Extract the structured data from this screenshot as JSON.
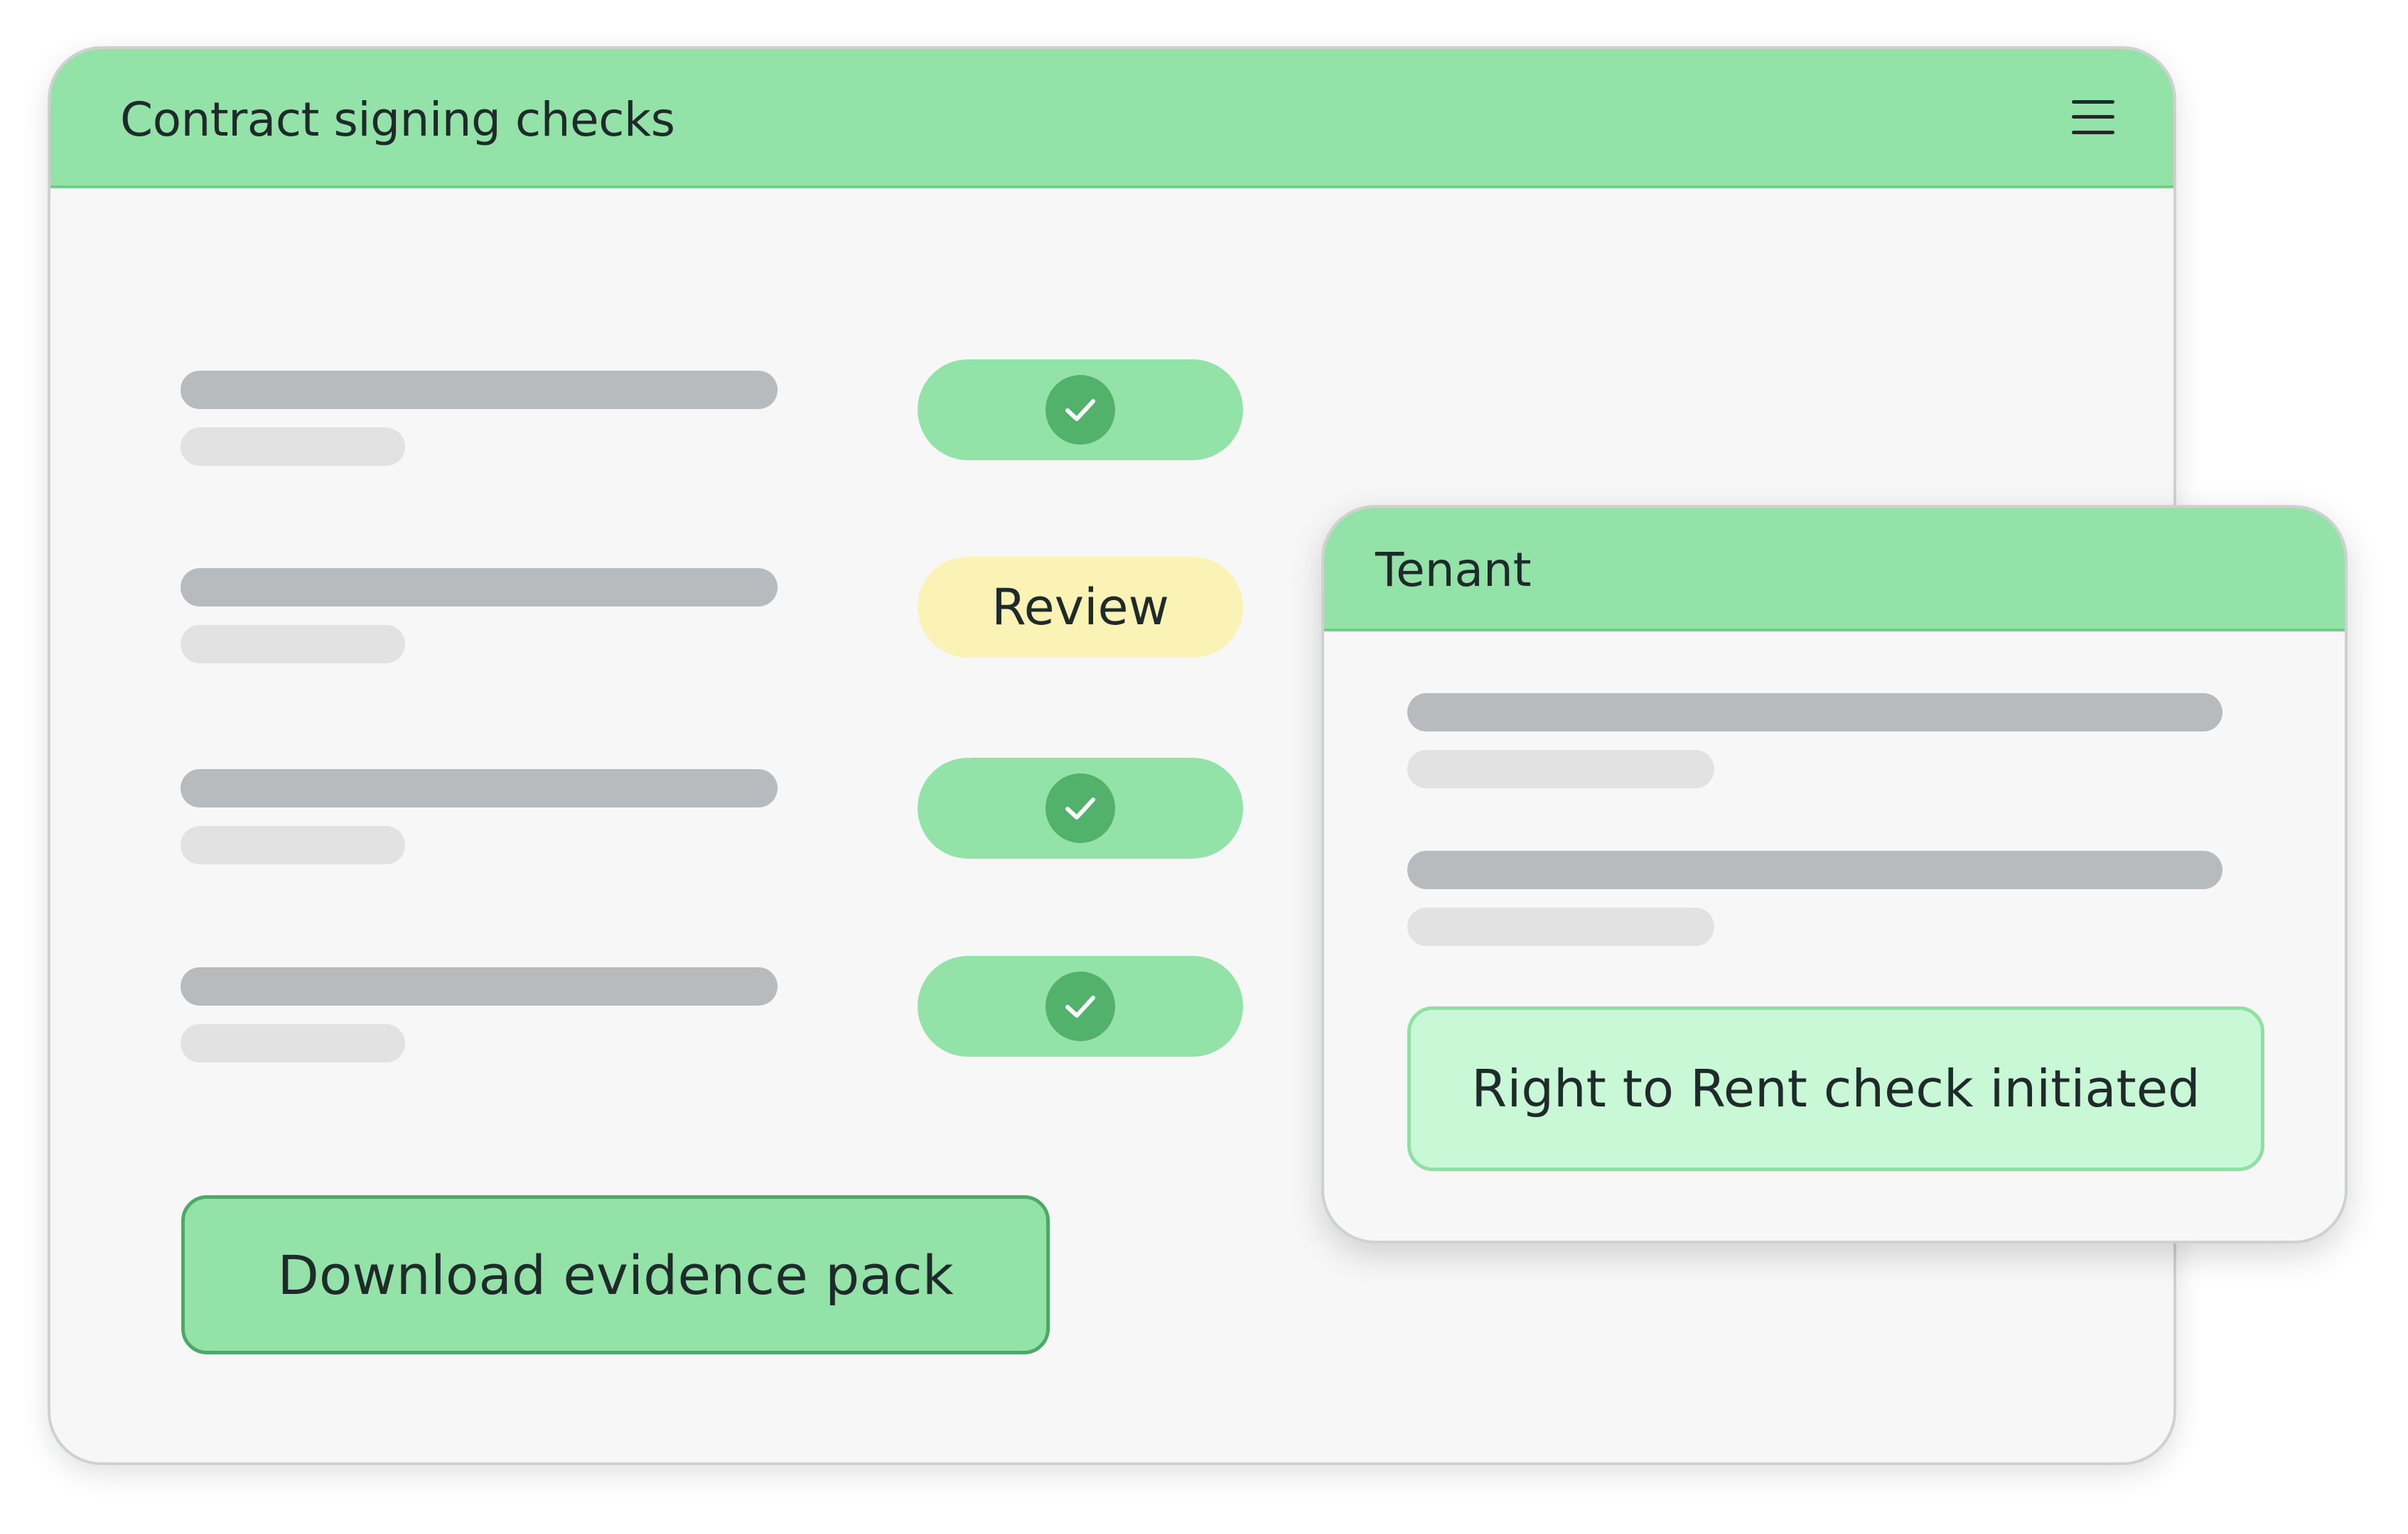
{
  "main_window": {
    "title": "Contract signing checks",
    "menu_icon": "hamburger-menu-icon",
    "checks": [
      {
        "status": "passed",
        "icon": "checkmark-icon",
        "label": ""
      },
      {
        "status": "review",
        "icon": "",
        "label": "Review"
      },
      {
        "status": "passed",
        "icon": "checkmark-icon",
        "label": ""
      },
      {
        "status": "passed",
        "icon": "checkmark-icon",
        "label": ""
      }
    ],
    "download_label": "Download evidence pack"
  },
  "tenant_card": {
    "title": "Tenant",
    "status_text": "Right to Rent check initiated"
  },
  "colors": {
    "header_green": "#93e3a8",
    "check_green": "#52b26b",
    "review_yellow": "#fbf2b6",
    "status_mint": "#c9f8d6",
    "panel_bg": "#f7f7f7"
  }
}
